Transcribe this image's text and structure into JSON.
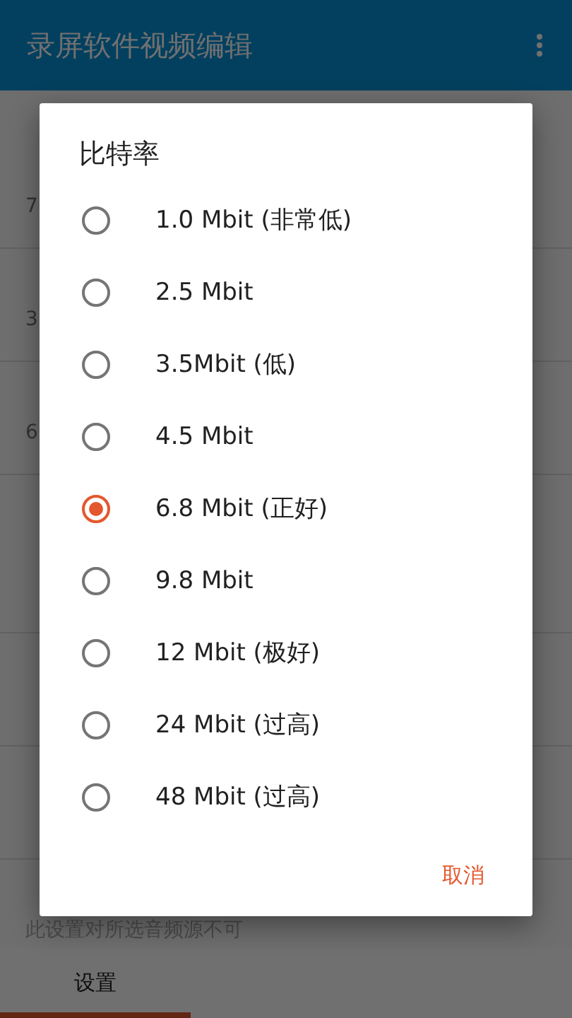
{
  "app_bar": {
    "title": "录屏软件视频编辑"
  },
  "settings": [
    {
      "kind": "header"
    },
    {
      "kind": "item",
      "summary": "7",
      "disabled": false
    },
    {
      "kind": "item",
      "summary": "3",
      "disabled": false
    },
    {
      "kind": "item",
      "summary": "6",
      "disabled": false
    },
    {
      "kind": "header"
    },
    {
      "kind": "item"
    },
    {
      "kind": "item"
    },
    {
      "kind": "item"
    },
    {
      "kind": "item",
      "summary": "此设置对所选音频源不可",
      "disabled": true
    }
  ],
  "bottom_tabs": [
    {
      "label": "设置",
      "selected": true
    }
  ],
  "dialog": {
    "title": "比特率",
    "options": [
      {
        "label": "1.0 Mbit (非常低)",
        "selected": false
      },
      {
        "label": "2.5 Mbit",
        "selected": false
      },
      {
        "label": "3.5Mbit (低)",
        "selected": false
      },
      {
        "label": "4.5 Mbit",
        "selected": false
      },
      {
        "label": "6.8 Mbit (正好)",
        "selected": true
      },
      {
        "label": "9.8 Mbit",
        "selected": false
      },
      {
        "label": "12 Mbit (极好)",
        "selected": false
      },
      {
        "label": "24 Mbit (过高)",
        "selected": false
      },
      {
        "label": "48 Mbit (过高)",
        "selected": false
      }
    ],
    "cancel": "取消"
  }
}
